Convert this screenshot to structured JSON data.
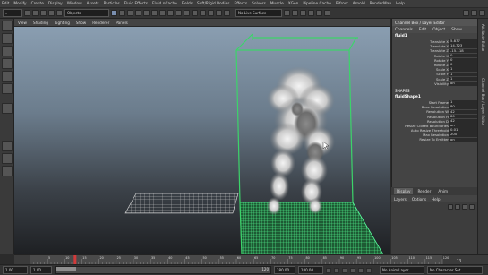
{
  "menubar": [
    "Edit",
    "Modify",
    "Create",
    "Display",
    "Window",
    "Assets",
    "Particles",
    "Fluid Effects",
    "Fluid nCache",
    "Fields",
    "Soft/Rigid Bodies",
    "Effects",
    "Solvers",
    "Muscle",
    "XGen",
    "Pipeline Cache",
    "Bifrost",
    "Arnold",
    "RenderMan",
    "Help"
  ],
  "shelf": {
    "objects_label": "Objects",
    "live_surface": "No Live Surface"
  },
  "panel_menu": [
    "View",
    "Shading",
    "Lighting",
    "Show",
    "Renderer",
    "Panels"
  ],
  "channel_box": {
    "title": "Channel Box / Layer Editor",
    "menu": [
      "Channels",
      "Edit",
      "Object",
      "Show"
    ],
    "object_name": "fluid1",
    "transform_attrs": [
      {
        "label": "Translate X",
        "value": "5.877"
      },
      {
        "label": "Translate Y",
        "value": "14.723"
      },
      {
        "label": "Translate Z",
        "value": "-15.118"
      },
      {
        "label": "Rotate X",
        "value": "0"
      },
      {
        "label": "Rotate Y",
        "value": "0"
      },
      {
        "label": "Rotate Z",
        "value": "0"
      },
      {
        "label": "Scale X",
        "value": "1"
      },
      {
        "label": "Scale Y",
        "value": "1"
      },
      {
        "label": "Scale Z",
        "value": "1"
      },
      {
        "label": "Visibility",
        "value": "on"
      }
    ],
    "shapes_header": "SHAPES",
    "shape_name": "fluidShape1",
    "shape_attrs": [
      {
        "label": "Start Frame",
        "value": "1"
      },
      {
        "label": "Base Resolution",
        "value": "80"
      },
      {
        "label": "Resolution W",
        "value": "42"
      },
      {
        "label": "Resolution H",
        "value": "80"
      },
      {
        "label": "Resolution D",
        "value": "42"
      },
      {
        "label": "Resize Closed Boundaries",
        "value": "on"
      },
      {
        "label": "Auto Resize Threshold",
        "value": "0.01"
      },
      {
        "label": "Max Resolution",
        "value": "200"
      },
      {
        "label": "Resize To Emitter",
        "value": "on"
      }
    ]
  },
  "layer_editor": {
    "tabs": [
      "Display",
      "Render",
      "Anim"
    ],
    "menu": [
      "Layers",
      "Options",
      "Help"
    ]
  },
  "side_tabs": [
    "Attribute Editor",
    "Channel Box / Layer Editor"
  ],
  "timeline": {
    "ticks": [
      "5",
      "10",
      "15",
      "20",
      "25",
      "30",
      "35",
      "40",
      "45",
      "50",
      "55",
      "60",
      "65",
      "70",
      "75",
      "80",
      "85",
      "90",
      "95",
      "100",
      "105",
      "110",
      "115",
      "120"
    ],
    "current_frame": "13"
  },
  "range": {
    "start": "1.00",
    "start_inner": "1.00",
    "end_inner": "120",
    "end": "180.00",
    "end_outer": "180.00",
    "anim_layer": "No Anim Layer",
    "char_set": "No Character Set"
  },
  "colors": {
    "viewport_top": "#8a9eb1",
    "grid_green": "#4cff8c",
    "bbox_green": "#3cd46a",
    "current_frame_red": "#d23a3a"
  }
}
